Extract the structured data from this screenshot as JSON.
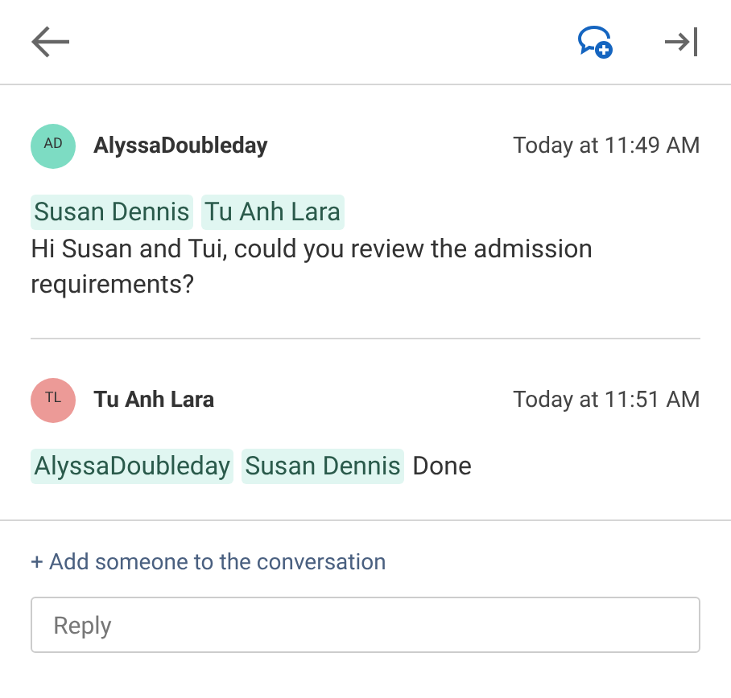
{
  "messages": [
    {
      "initials": "AD",
      "color": "#7ddcc3",
      "author": "AlyssaDoubleday",
      "time": "Today at 11:49 AM",
      "mentions": [
        "Susan Dennis",
        "Tu Anh Lara"
      ],
      "text": "Hi Susan and Tui, could you review the admission requirements?"
    },
    {
      "initials": "TL",
      "color": "#ec9a97",
      "author": "Tu Anh Lara",
      "time": "Today at 11:51 AM",
      "mentions": [
        "AlyssaDoubleday",
        "Susan Dennis"
      ],
      "text": "Done"
    }
  ],
  "add_link": "+ Add someone to the conversation",
  "reply": {
    "placeholder": "Reply"
  }
}
